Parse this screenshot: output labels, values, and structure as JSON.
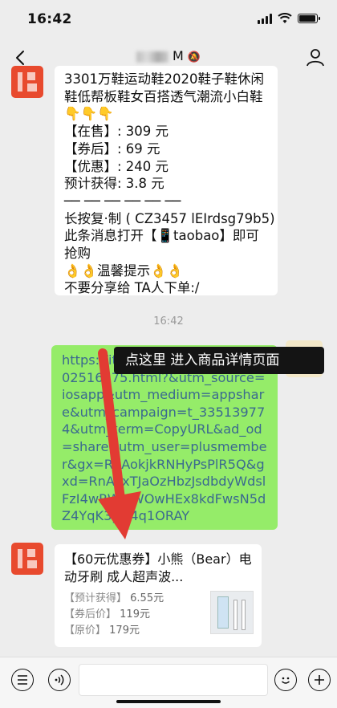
{
  "status": {
    "time": "16:42"
  },
  "nav": {
    "title_suffix": "M",
    "mute_icon": "🔕"
  },
  "message1": {
    "lines": [
      "3301万鞋运动鞋2020鞋子鞋休闲",
      "鞋低帮板鞋女百搭透气潮流小白鞋",
      "👇👇👇",
      "【在售】:  309 元",
      "【券后】:  69 元",
      "【优惠】:  240 元",
      "预计获得:  3.8 元",
      "── ── ── ── ── ──",
      "长按复·制 ( CZ3457 lEIrdsg79b5)",
      "此条消息打开【📱taobao】即可",
      "抢购",
      "👌👌温馨提示👌👌",
      "不要分享给 TA人下单:/"
    ]
  },
  "timestamp": "16:42",
  "message2": {
    "url": "https://item.taobao.com/item/602516275.html?&utm_source=iosapp&utm_medium=appshare&utm_campaign=t_335139774&utm_term=CopyURL&ad_od=share&utm_user=plusmember&gx=RnAokjkRNHyPsPlR5Q&gxd=RnAoxTJaOzHbzJsdbdyWdslFzI4wRWMWOwHEx8kdFwsN5dZ4YqK3yw4q1ORAY"
  },
  "tooltip": "点这里  进入商品详情页面",
  "message3": {
    "title": "【60元优惠券】小熊（Bear）电动牙刷 成人超声波...",
    "est_label": "【预计获得】",
    "est_value": "6.55元",
    "after_label": "【券后价】",
    "after_value": "119元",
    "orig_label": "【原价】",
    "orig_value": "179元"
  },
  "colors": {
    "sent_bubble": "#95ec69",
    "arrow": "#e23b33",
    "link": "#3b6a8f"
  }
}
